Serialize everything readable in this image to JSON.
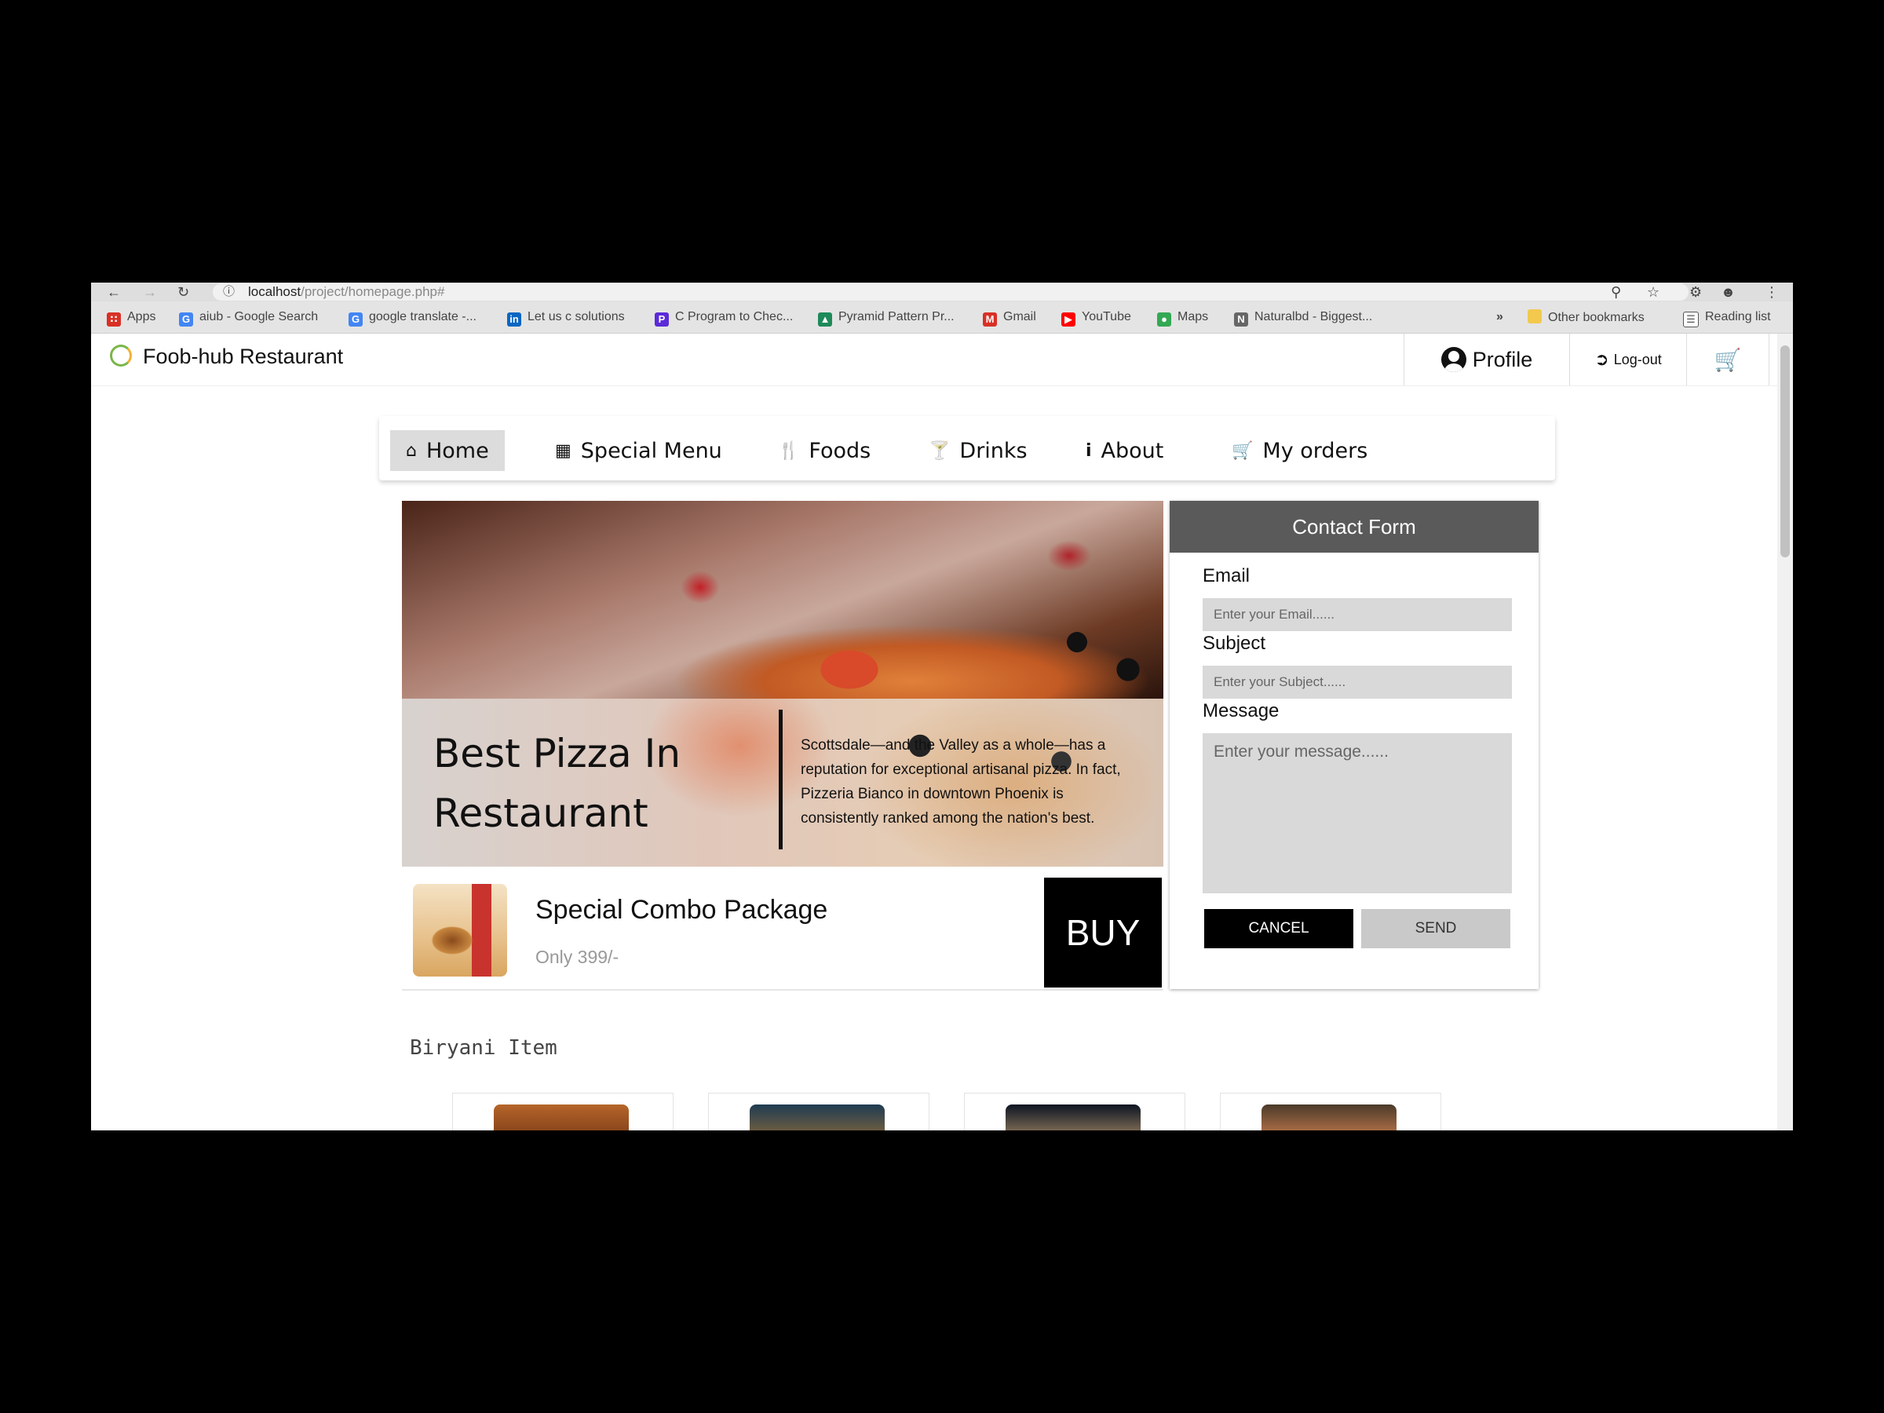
{
  "browser": {
    "url_host": "localhost",
    "url_path": "/project/homepage.php#",
    "bookmarks": [
      {
        "label": "Apps",
        "icon": "apps-grid-icon",
        "color": "#d93025"
      },
      {
        "label": "aiub - Google Search",
        "icon": "google-icon",
        "color": "#4285f4"
      },
      {
        "label": "google translate -...",
        "icon": "google-icon",
        "color": "#4285f4"
      },
      {
        "label": "Let us c solutions",
        "icon": "linkedin-icon",
        "color": "#0a66c2"
      },
      {
        "label": "C Program to Chec...",
        "icon": "p-logo-icon",
        "color": "#5b2bd9"
      },
      {
        "label": "Pyramid Pattern Pr...",
        "icon": "site-icon",
        "color": "#1e8a5a"
      },
      {
        "label": "Gmail",
        "icon": "gmail-icon",
        "color": "#d93025"
      },
      {
        "label": "YouTube",
        "icon": "youtube-icon",
        "color": "#ff0000"
      },
      {
        "label": "Maps",
        "icon": "maps-icon",
        "color": "#34a853"
      },
      {
        "label": "Naturalbd - Biggest...",
        "icon": "site-icon",
        "color": "#666666"
      }
    ],
    "more": "»",
    "other_bookmarks": "Other bookmarks",
    "reading_list": "Reading list"
  },
  "header": {
    "site_title": "Foob-hub Restaurant",
    "profile_label": "Profile",
    "logout_label": "Log-out"
  },
  "nav": [
    {
      "label": "Home",
      "icon": "home-icon"
    },
    {
      "label": "Special Menu",
      "icon": "grid-icon"
    },
    {
      "label": "Foods",
      "icon": "utensils-icon"
    },
    {
      "label": "Drinks",
      "icon": "cocktail-icon"
    },
    {
      "label": "About",
      "icon": "info-icon"
    },
    {
      "label": "My orders",
      "icon": "cart-icon"
    }
  ],
  "hero": {
    "title": "Best Pizza In Restaurant",
    "description": "Scottsdale—and the Valley as a whole—has a reputation for exceptional artisanal pizza. In fact, Pizzeria Bianco in downtown Phoenix is consistently ranked among the nation's best."
  },
  "combo": {
    "title": "Special Combo Package",
    "price": "Only 399/-",
    "buy_label": "BUY"
  },
  "contact": {
    "title": "Contact Form",
    "email_label": "Email",
    "email_placeholder": "Enter your Email......",
    "subject_label": "Subject",
    "subject_placeholder": "Enter your Subject......",
    "message_label": "Message",
    "message_placeholder": "Enter your message......",
    "cancel_label": "CANCEL",
    "send_label": "SEND"
  },
  "biryani": {
    "title": "Biryani Item"
  }
}
